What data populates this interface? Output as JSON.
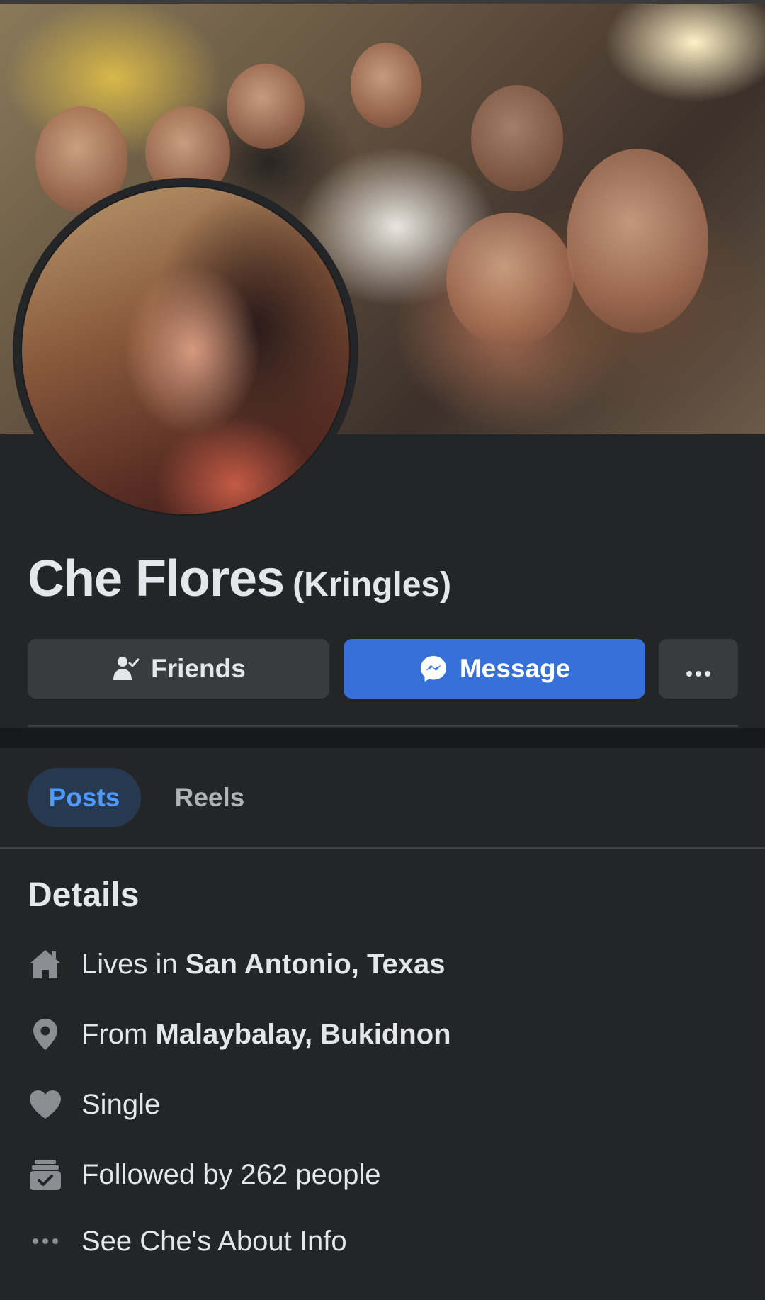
{
  "profile": {
    "name": "Che Flores",
    "nickname": "(Kringles)"
  },
  "actions": {
    "friends_label": "Friends",
    "message_label": "Message",
    "more_label": "..."
  },
  "tabs": [
    {
      "label": "Posts",
      "active": true
    },
    {
      "label": "Reels",
      "active": false
    }
  ],
  "details": {
    "title": "Details",
    "lives_prefix": "Lives in ",
    "lives_place": "San Antonio, Texas",
    "from_prefix": "From ",
    "from_place": "Malaybalay, Bukidnon",
    "relationship": "Single",
    "followers": "Followed by 262 people",
    "about_link": "See Che's About Info"
  },
  "icons": {
    "friends": "person-check-icon",
    "message": "messenger-icon",
    "more": "more-dots-icon",
    "lives": "home-icon",
    "from": "location-pin-icon",
    "relationship": "heart-icon",
    "followers": "followers-icon",
    "about": "more-dots-icon"
  },
  "colors": {
    "background": "#242526",
    "accent": "#3670d8",
    "tab_active_bg": "#263951",
    "tab_active_text": "#4d9aff",
    "text": "#e4e6eb",
    "muted": "#b0b3b8"
  }
}
